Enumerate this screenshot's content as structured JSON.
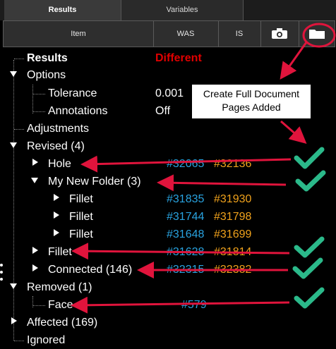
{
  "tabs": {
    "results": "Results",
    "variables": "Variables"
  },
  "columns": {
    "item": "Item",
    "was": "WAS",
    "is": "IS",
    "camera_icon": "camera-icon",
    "folder_icon": "folder-icon"
  },
  "tree": {
    "results": {
      "label": "Results",
      "status": "Different"
    },
    "options": {
      "label": "Options",
      "tolerance": {
        "label": "Tolerance",
        "value": "0.001"
      },
      "annotations": {
        "label": "Annotations",
        "value": "Off"
      }
    },
    "adjustments": {
      "label": "Adjustments"
    },
    "revised": {
      "label": "Revised (4)",
      "hole": {
        "label": "Hole",
        "was": "#32065",
        "is": "#32136"
      },
      "folder": {
        "label": "My New Folder (3)",
        "fillet1": {
          "label": "Fillet",
          "was": "#31835",
          "is": "#31930"
        },
        "fillet2": {
          "label": "Fillet",
          "was": "#31744",
          "is": "#31798"
        },
        "fillet3": {
          "label": "Fillet",
          "was": "#31648",
          "is": "#31699"
        }
      },
      "fillet": {
        "label": "Fillet",
        "was": "#31628",
        "is": "#31814"
      },
      "connected": {
        "label": "Connected (146)",
        "was": "#32315",
        "is": "#32382"
      }
    },
    "removed": {
      "label": "Removed (1)",
      "face": {
        "label": "Face",
        "was": "#579"
      }
    },
    "affected": {
      "label": "Affected (169)"
    },
    "ignored": {
      "label": "Ignored"
    }
  },
  "callout": {
    "line1": "Create Full Document",
    "line2": "Pages Added"
  },
  "colors": {
    "annotation": "#e0143c",
    "check": "#2bb98a",
    "was": "#29a3e0",
    "is": "#f0a21c",
    "different": "#e00000"
  }
}
